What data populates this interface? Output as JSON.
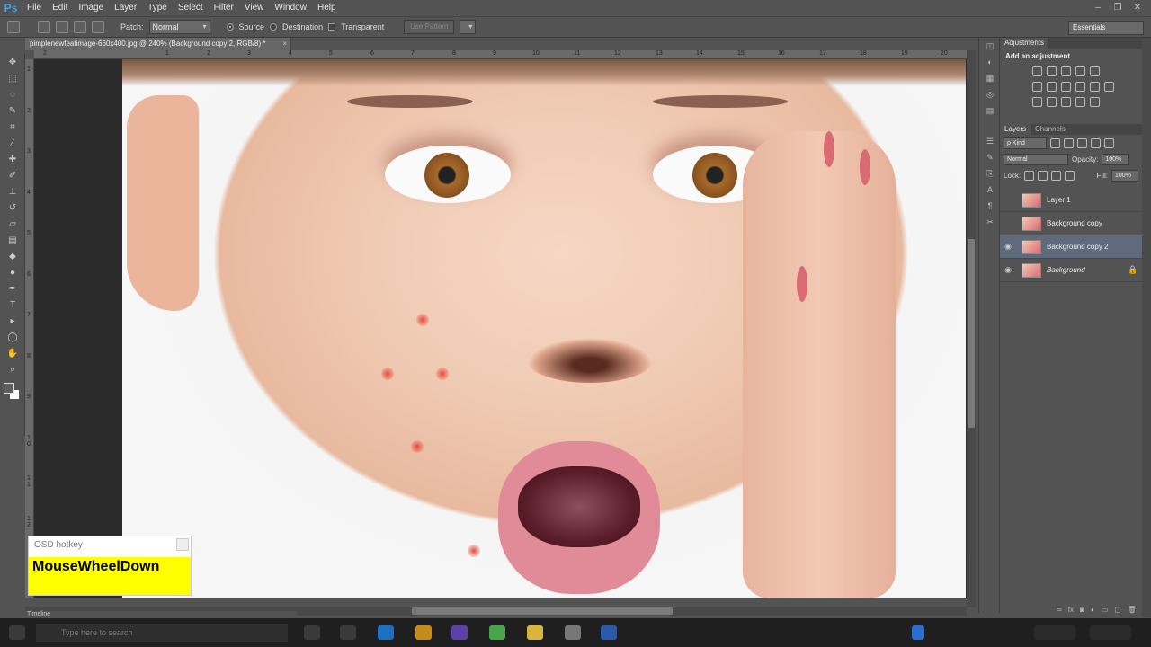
{
  "app": {
    "logo": "Ps",
    "menus": [
      "File",
      "Edit",
      "Image",
      "Layer",
      "Type",
      "Select",
      "Filter",
      "View",
      "Window",
      "Help"
    ]
  },
  "options": {
    "patch_label": "Patch:",
    "patch_value": "Normal",
    "source_label": "Source",
    "destination_label": "Destination",
    "transparent_label": "Transparent",
    "use_pattern_label": "Use Pattern",
    "workspace": "Essentials"
  },
  "document": {
    "tab_title": "pimplenewfeatimage-660x400.jpg @ 240% (Background copy 2, RGB/8) *",
    "ruler_top": [
      "2",
      "1",
      "2",
      "3",
      "4",
      "5",
      "6",
      "7",
      "8",
      "9",
      "10",
      "11",
      "12",
      "13",
      "14",
      "15",
      "16",
      "17",
      "18",
      "19",
      "20",
      "21",
      "22"
    ],
    "ruler_left": [
      "1",
      "2",
      "3",
      "4",
      "5",
      "6",
      "7",
      "8",
      "9",
      "1 0",
      "1 1",
      "1 2"
    ]
  },
  "osd": {
    "title": "OSD hotkey",
    "message": "MouseWheelDown"
  },
  "timeline": {
    "label": "Timeline"
  },
  "adjustments": {
    "tab_adjustments": "Adjustments",
    "title": "Add an adjustment"
  },
  "layers_panel": {
    "tab_layers": "Layers",
    "tab_channels": "Channels",
    "kind_label": "ρ Kind",
    "blend_mode": "Normal",
    "opacity_label": "Opacity:",
    "opacity_value": "100%",
    "lock_label": "Lock:",
    "fill_label": "Fill:",
    "fill_value": "100%",
    "layers": [
      {
        "name": "Layer 1",
        "visible": false,
        "selected": false,
        "locked": false
      },
      {
        "name": "Background copy",
        "visible": false,
        "selected": false,
        "locked": false
      },
      {
        "name": "Background copy 2",
        "visible": true,
        "selected": true,
        "locked": false
      },
      {
        "name": "Background",
        "visible": true,
        "selected": false,
        "locked": true
      }
    ]
  },
  "taskbar": {
    "search_placeholder": "Type here to search"
  },
  "colors": {
    "ui_background": "#535353",
    "selected_layer": "#606a7d",
    "osd_yellow": "#ffff00",
    "ps_blue": "#31a8ff"
  }
}
